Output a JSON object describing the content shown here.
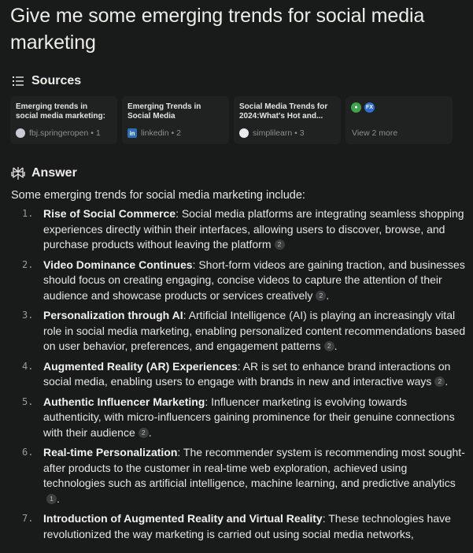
{
  "question": "Give me some emerging trends for social media marketing",
  "sources": {
    "heading": "Sources",
    "cards": [
      {
        "title": "Emerging trends in social media marketing: a...",
        "site": "fbj.springeropen",
        "index": "1"
      },
      {
        "title": "Emerging Trends in Social Media Marketing:...",
        "site": "linkedin",
        "index": "2"
      },
      {
        "title": "Social Media Trends for 2024:What's Hot and...",
        "site": "simplilearn",
        "index": "3"
      }
    ],
    "more_label": "View 2 more"
  },
  "answer": {
    "heading": "Answer",
    "intro": "Some emerging trends for social media marketing include:",
    "items": [
      {
        "num": "1.",
        "title": "Rise of Social Commerce",
        "text": ": Social media platforms are integrating seamless shopping experiences directly within their interfaces, allowing users to discover, browse, and purchase products without leaving the platform",
        "cite": "2",
        "end": ""
      },
      {
        "num": "2.",
        "title": "Video Dominance Continues",
        "text": ": Short-form videos are gaining traction, and businesses should focus on creating engaging, concise videos to capture the attention of their audience and showcase products or services creatively",
        "cite": "2",
        "end": "."
      },
      {
        "num": "3.",
        "title": "Personalization through AI",
        "text": ": Artificial Intelligence (AI) is playing an increasingly vital role in social media marketing, enabling personalized content recommendations based on user behavior, preferences, and engagement patterns",
        "cite": "2",
        "end": "."
      },
      {
        "num": "4.",
        "title": "Augmented Reality (AR) Experiences",
        "text": ": AR is set to enhance brand interactions on social media, enabling users to engage with brands in new and interactive ways",
        "cite": "2",
        "end": "."
      },
      {
        "num": "5.",
        "title": "Authentic Influencer Marketing",
        "text": ": Influencer marketing is evolving towards authenticity, with micro-influencers gaining prominence for their genuine connections with their audience",
        "cite": "2",
        "end": "."
      },
      {
        "num": "6.",
        "title": "Real-time Personalization",
        "text": ": The recommender system is recommending most sought-after products to the customer in real-time web exploration, achieved using technologies such as artificial intelligence, machine learning, and predictive analytics",
        "cite": "1",
        "end": "."
      },
      {
        "num": "7.",
        "title": "Introduction of Augmented Reality and Virtual Reality",
        "text": ": These technologies have revolutionized the way marketing is carried out using social media networks,",
        "cite": "",
        "end": ""
      }
    ]
  }
}
